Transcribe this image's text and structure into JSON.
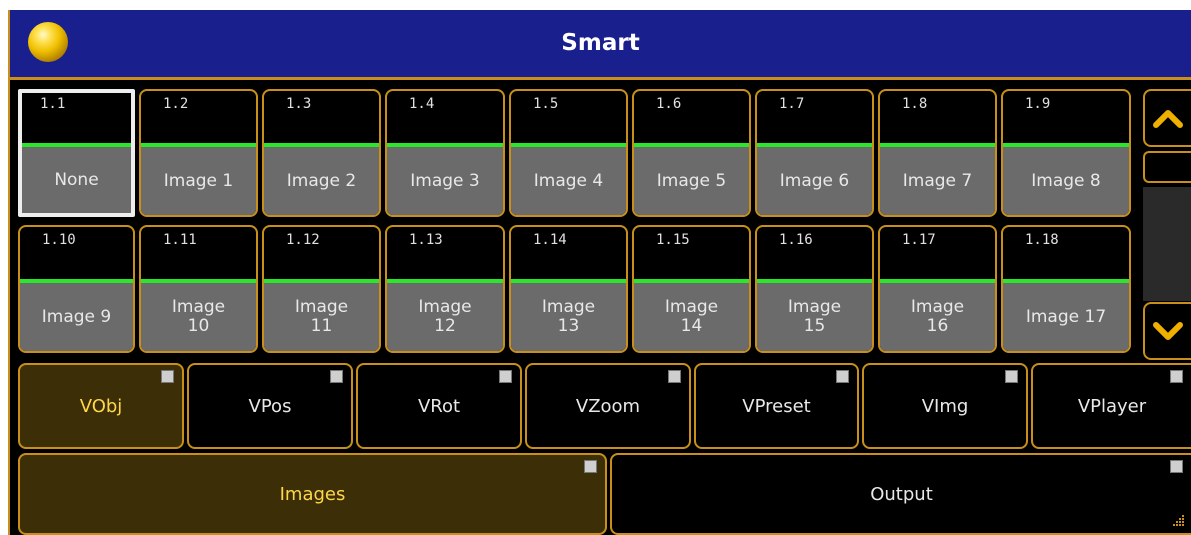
{
  "window": {
    "title": "Smart",
    "logo": "yellow-ball-icon",
    "colors": {
      "titlebar": "#1a1f8e",
      "border": "#c8901a",
      "level_bar": "#2ce62c",
      "active_tab": "#3c2e06",
      "active_text": "#ffd84a"
    }
  },
  "grid": {
    "row1": [
      {
        "num": "1.1",
        "label": "None",
        "selected": true
      },
      {
        "num": "1.2",
        "label": "Image 1"
      },
      {
        "num": "1.3",
        "label": "Image 2"
      },
      {
        "num": "1.4",
        "label": "Image 3"
      },
      {
        "num": "1.5",
        "label": "Image 4"
      },
      {
        "num": "1.6",
        "label": "Image 5"
      },
      {
        "num": "1.7",
        "label": "Image 6"
      },
      {
        "num": "1.8",
        "label": "Image 7"
      },
      {
        "num": "1.9",
        "label": "Image 8"
      }
    ],
    "row2": [
      {
        "num": "1.10",
        "label": "Image 9"
      },
      {
        "num": "1.11",
        "label": "Image\n10"
      },
      {
        "num": "1.12",
        "label": "Image\n11"
      },
      {
        "num": "1.13",
        "label": "Image\n12"
      },
      {
        "num": "1.14",
        "label": "Image\n13"
      },
      {
        "num": "1.15",
        "label": "Image\n14"
      },
      {
        "num": "1.16",
        "label": "Image\n15"
      },
      {
        "num": "1.17",
        "label": "Image\n16"
      },
      {
        "num": "1.18",
        "label": "Image 17"
      }
    ]
  },
  "scroll": {
    "up_icon": "chevron-up-icon",
    "down_icon": "chevron-down-icon"
  },
  "tabs": [
    "VObj",
    "VPos",
    "VRot",
    "VZoom",
    "VPreset",
    "VImg",
    "VPlayer"
  ],
  "active_tab": "VObj",
  "bottom": {
    "images": "Images",
    "output": "Output",
    "active": "Images"
  }
}
